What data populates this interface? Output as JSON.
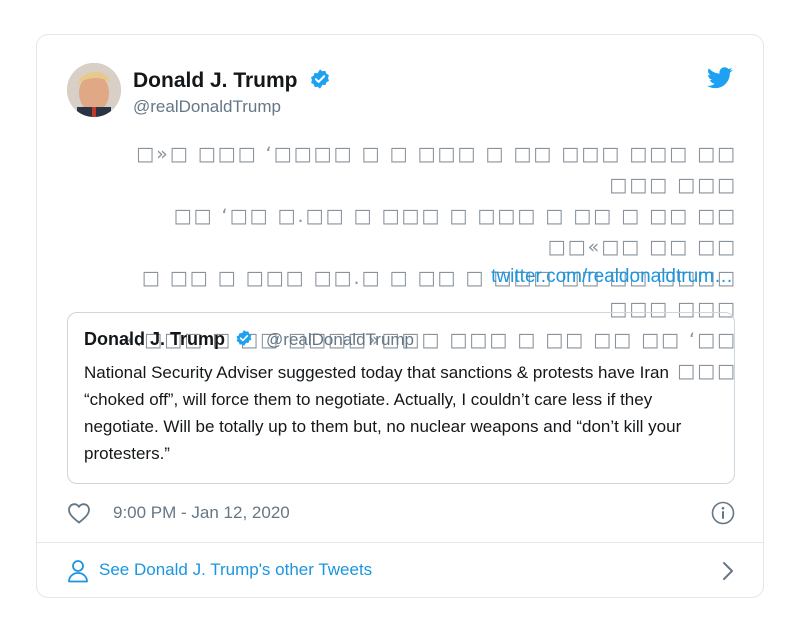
{
  "author": {
    "name": "Donald J. Trump",
    "handle": "@realDonaldTrump",
    "verified": true
  },
  "icons": {
    "verified": "verified-badge-icon",
    "brand": "twitter-bird-icon",
    "like": "heart-icon",
    "info": "info-icon",
    "profile": "person-icon",
    "more": "chevron-right-icon"
  },
  "colors": {
    "accent": "#1b95e0",
    "secondary_text": "#657786",
    "border": "#e1e8ed"
  },
  "tweet": {
    "text_lines": [
      "□»□ □□□ ‘□□□□ □ □ □□□ □ □□ □□□ □□□ □□ □□□ □□□",
      "□□ ‘□□ □.□□ □ □□□ □ □□□ □ □□ □ □□ □□ □□«□□ □□ □□",
      "□ □□ □ □□□ □□.□ □ □□ □ □□□ □□ □□ □□□□ □□□ □□□",
      "«.□□□ □ □□ □□□□»□□□ □□□ □ □□ □□ □□ ‘□□ □□□"
    ],
    "link": "twitter.com/realdonaldtrum…"
  },
  "quoted_tweet": {
    "name": "Donald J. Trump",
    "handle": "@realDonaldTrump",
    "text": "National Security Adviser suggested today that sanctions & protests have Iran “choked off”, will force them to negotiate. Actually, I couldn’t care less if they negotiate. Will be totally up to them but, no nuclear weapons and “don’t kill your protesters.”"
  },
  "meta": {
    "timestamp": "9:00 PM - Jan 12, 2020"
  },
  "footer": {
    "label": "See Donald J. Trump's other Tweets"
  }
}
